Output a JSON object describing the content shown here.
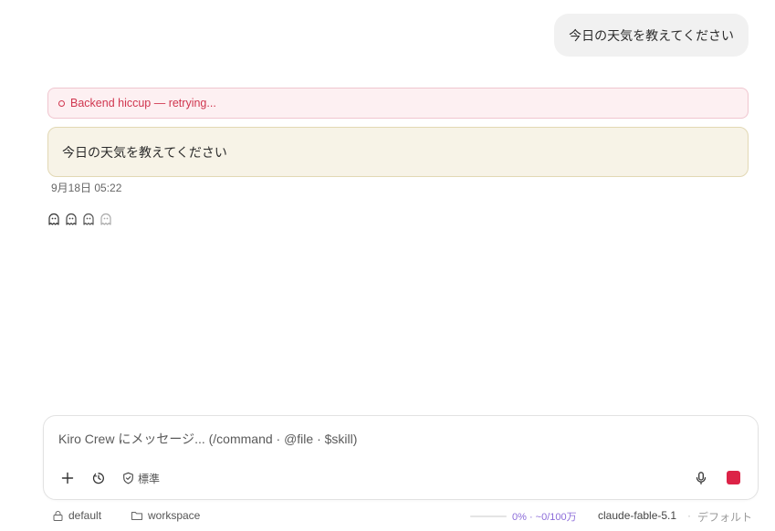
{
  "conversation": {
    "user_message": "今日の天気を教えてください",
    "error_banner": "Backend hiccup — retrying...",
    "reply_text": "今日の天気を教えてください",
    "timestamp": "9月18日 05:22"
  },
  "composer": {
    "placeholder": "Kiro Crew にメッセージ... (/command · @file · $skill)",
    "mode_label": "標準",
    "stop_color": "#dc2347"
  },
  "statusbar": {
    "profile": "default",
    "folder": "workspace",
    "usage_progress": 0.0,
    "usage_text": "0% · ~0/100万",
    "model": "claude-fable-5.1",
    "separator": "·",
    "preset": "デフォルト"
  },
  "icons": {
    "ghosts": [
      "ghost-icon",
      "ghost-icon",
      "ghost-icon",
      "ghost-faded-icon"
    ],
    "composer_tools": [
      "plus-icon",
      "timer-icon",
      "shield-check-icon",
      "microphone-icon",
      "stop-icon"
    ],
    "statusbar": [
      "lock-icon",
      "folder-icon"
    ]
  },
  "colors": {
    "error": "#d0364f",
    "reply_card_bg": "#f7f3e7",
    "accent": "#8c6cd9"
  }
}
